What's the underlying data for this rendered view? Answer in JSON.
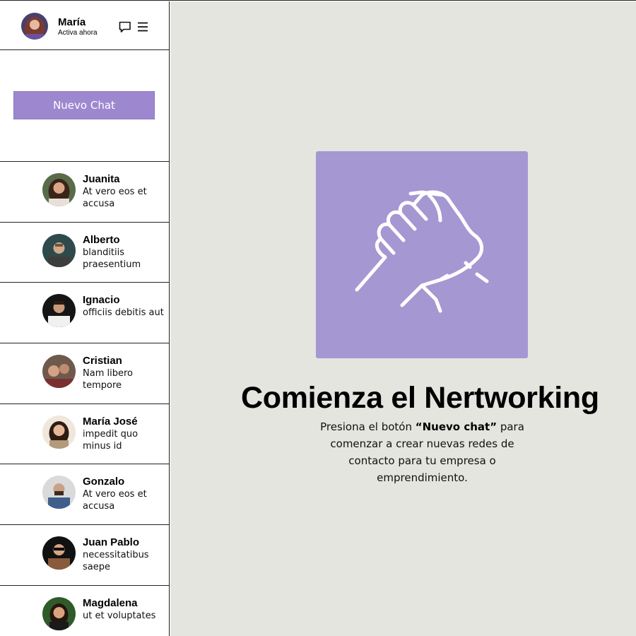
{
  "user": {
    "name": "María",
    "status": "Activa ahora"
  },
  "icons": {
    "chat": "chat-bubble-icon",
    "menu": "hamburger-menu-icon",
    "hero": "handshake-icon"
  },
  "colors": {
    "accent": "#9d88d0",
    "hero_card": "#a597d2",
    "main_bg": "#e4e5df"
  },
  "sidebar": {
    "new_chat_label": "Nuevo Chat"
  },
  "contacts": [
    {
      "name": "Juanita",
      "message": "At vero eos et accusa"
    },
    {
      "name": "Alberto",
      "message": "blanditiis praesentium"
    },
    {
      "name": "Ignacio",
      "message": "officiis debitis aut"
    },
    {
      "name": "Cristian",
      "message": "Nam libero tempore"
    },
    {
      "name": "María José",
      "message": "impedit quo minus id"
    },
    {
      "name": "Gonzalo",
      "message": "At vero eos et accusa"
    },
    {
      "name": "Juan Pablo",
      "message": "necessitatibus saepe"
    },
    {
      "name": "Magdalena",
      "message": "ut et voluptates"
    }
  ],
  "main": {
    "title": "Comienza el Nertworking",
    "desc_before": "Presiona el botón ",
    "desc_bold": "“Nuevo chat”",
    "desc_after": " para comenzar a crear nuevas redes de contacto para tu empresa o emprendimiento."
  }
}
